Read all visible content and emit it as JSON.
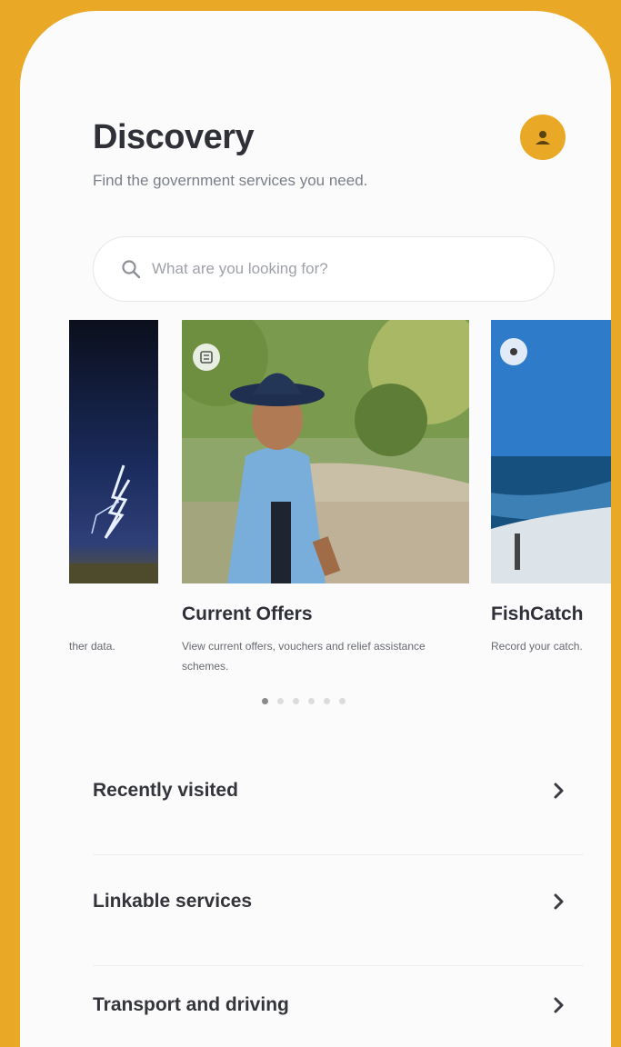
{
  "header": {
    "title": "Discovery",
    "subtitle": "Find the government services you need."
  },
  "search": {
    "placeholder": "What are you looking for?"
  },
  "carousel": {
    "cards": [
      {
        "title": "",
        "description": "ther data."
      },
      {
        "title": "Current Offers",
        "description": "View current offers, vouchers and relief assistance schemes."
      },
      {
        "title": "FishCatch",
        "description": "Record your catch."
      }
    ],
    "page_count": 6,
    "active_index": 0
  },
  "list": {
    "items": [
      {
        "label": "Recently visited"
      },
      {
        "label": "Linkable services"
      },
      {
        "label": "Transport and driving"
      }
    ]
  },
  "colors": {
    "background": "#E9A825",
    "accent": "#E9A825",
    "text": "#2F3038"
  },
  "icons": {
    "avatar": "person-icon",
    "search": "search-icon",
    "chevron": "chevron-right-icon"
  }
}
